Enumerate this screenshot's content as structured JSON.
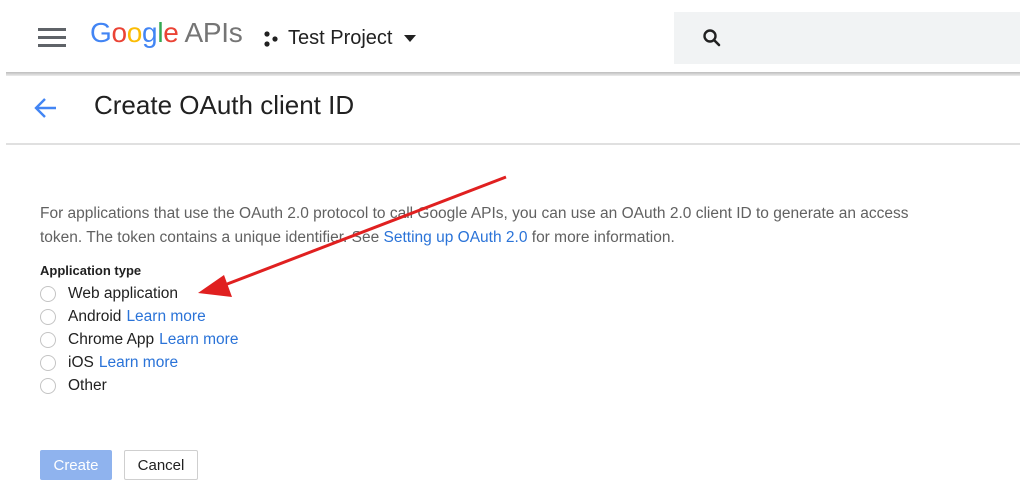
{
  "header": {
    "logo_google": [
      "G",
      "o",
      "o",
      "g",
      "l",
      "e"
    ],
    "logo_apis": "APIs",
    "project_name": "Test Project",
    "menu_icon": "hamburger-menu-icon",
    "project_icon": "project-dots-icon",
    "search_icon": "search-icon"
  },
  "page": {
    "back_icon": "arrow-left-icon",
    "title": "Create OAuth client ID"
  },
  "description": {
    "text_before": "For applications that use the OAuth 2.0 protocol to call Google APIs, you can use an OAuth 2.0 client ID to generate an access token. The token contains a unique identifier. See ",
    "link_text": "Setting up OAuth 2.0",
    "text_after": " for more information."
  },
  "application_type": {
    "label": "Application type",
    "options": [
      {
        "label": "Web application",
        "link": "",
        "selected": false
      },
      {
        "label": "Android",
        "link": "Learn more",
        "selected": false
      },
      {
        "label": "Chrome App",
        "link": "Learn more",
        "selected": false
      },
      {
        "label": "iOS",
        "link": "Learn more",
        "selected": false
      },
      {
        "label": "Other",
        "link": "",
        "selected": false
      }
    ]
  },
  "buttons": {
    "create": "Create",
    "cancel": "Cancel"
  },
  "colors": {
    "primary_link": "#2a73d8",
    "create_button_disabled": "#8fb3ee",
    "annotation_arrow": "#e02020"
  }
}
